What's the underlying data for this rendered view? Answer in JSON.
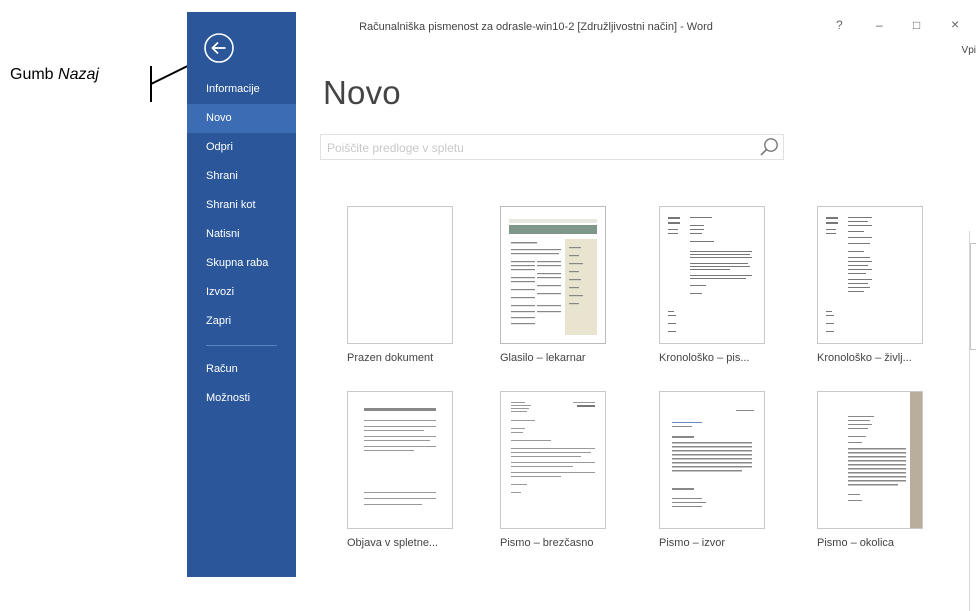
{
  "annotation": {
    "label_prefix": "Gumb ",
    "label_emphasis": "Nazaj"
  },
  "window": {
    "title": "Računalniška pismenost za odrasle-win10-2 [Združljivostni način] - Word",
    "controls": {
      "help": "?",
      "minimize": "–",
      "maximize": "□",
      "close": "×"
    },
    "signin_partial": "Vpi"
  },
  "sidebar": {
    "back_icon": "arrow-left-circle-icon",
    "items": [
      {
        "label": "Informacije",
        "active": false
      },
      {
        "label": "Novo",
        "active": true
      },
      {
        "label": "Odpri",
        "active": false
      },
      {
        "label": "Shrani",
        "active": false
      },
      {
        "label": "Shrani kot",
        "active": false
      },
      {
        "label": "Natisni",
        "active": false
      },
      {
        "label": "Skupna raba",
        "active": false
      },
      {
        "label": "Izvozi",
        "active": false
      },
      {
        "label": "Zapri",
        "active": false
      }
    ],
    "bottom_items": [
      {
        "label": "Račun"
      },
      {
        "label": "Možnosti"
      }
    ],
    "background_color": "#2b579a"
  },
  "main": {
    "heading": "Novo",
    "search": {
      "placeholder": "Poiščite predloge v spletu",
      "icon": "search-icon"
    },
    "templates": [
      {
        "label": "Prazen dokument"
      },
      {
        "label": "Glasilo – lekarnar"
      },
      {
        "label": "Kronološko – pis..."
      },
      {
        "label": "Kronološko – življ..."
      },
      {
        "label": "Objava v spletne..."
      },
      {
        "label": "Pismo – brezčasno"
      },
      {
        "label": "Pismo – izvor"
      },
      {
        "label": "Pismo – okolica"
      }
    ]
  }
}
